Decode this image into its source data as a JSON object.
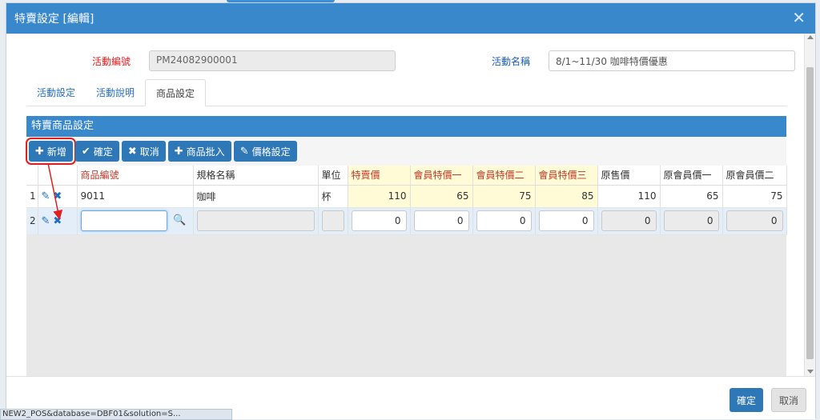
{
  "dialog": {
    "title": "特賣設定 [編輯]",
    "close_glyph": "✕"
  },
  "form": {
    "activity_no_label": "活動編號",
    "activity_no_value": "PM24082900001",
    "activity_name_label": "活動名稱",
    "activity_name_value": "8/1~11/30 咖啡特價優惠"
  },
  "tabs": [
    "活動設定",
    "活動說明",
    "商品設定"
  ],
  "panel": {
    "title": "特賣商品設定",
    "toolbar": {
      "add": "新增",
      "confirm": "確定",
      "cancel": "取消",
      "batch": "商品批入",
      "price": "價格設定"
    }
  },
  "grid": {
    "headers": [
      "商品編號",
      "規格名稱",
      "單位",
      "特賣價",
      "會員特價一",
      "會員特價二",
      "會員特價三",
      "原售價",
      "原會員價一",
      "原會員價二"
    ],
    "rows": [
      {
        "no": "1",
        "code": "9011",
        "spec": "咖啡",
        "unit": "杯",
        "sale": "110",
        "m1": "65",
        "m2": "75",
        "m3": "85",
        "orig": "110",
        "om1": "65",
        "om2": "75"
      },
      {
        "no": "2",
        "code": "",
        "spec": "",
        "unit": "",
        "sale": "0",
        "m1": "0",
        "m2": "0",
        "m3": "0",
        "orig": "0",
        "om1": "0",
        "om2": "0"
      }
    ]
  },
  "footer": {
    "ok": "確定",
    "cancel": "取消"
  },
  "statusbar": "NEW2_POS&database=DBF01&solution=S...",
  "colors": {
    "accent": "#3a88cc",
    "button": "#2f78b8",
    "highlight": "#fffbd6",
    "required_label": "#e02020"
  }
}
